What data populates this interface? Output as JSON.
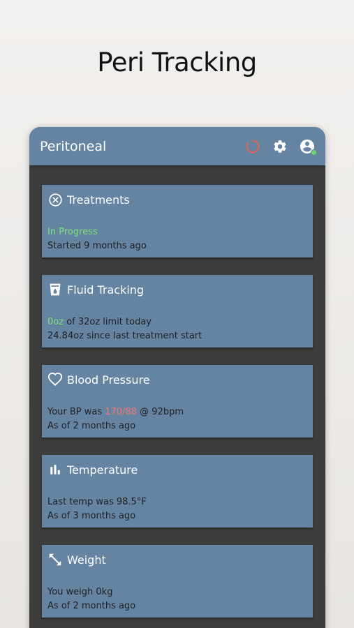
{
  "hero": {
    "title": "Peri Tracking"
  },
  "appbar": {
    "title": "Peritoneal",
    "actions": [
      {
        "icon": "loading-spinner-icon",
        "color": "#e06458"
      },
      {
        "icon": "gear-icon"
      },
      {
        "icon": "account-circle-icon",
        "badge_color": "#6ad477"
      }
    ]
  },
  "cards": {
    "treatments": {
      "icon": "close-circle-icon",
      "title": "Treatments",
      "status": "In Progress",
      "line2": "Started 9 months ago"
    },
    "fluid": {
      "icon": "cup-icon",
      "title": "Fluid Tracking",
      "amount": "0oz",
      "limit_text": " of 32oz limit today",
      "line2": "24.84oz since last treatment start"
    },
    "bp": {
      "icon": "heart-icon",
      "title": "Blood Pressure",
      "prefix": "Your BP was ",
      "value": "170/88",
      "suffix": " @ 92bpm",
      "line2": "As of 2 months ago"
    },
    "temperature": {
      "icon": "bar-chart-icon",
      "title": "Temperature",
      "line1": "Last temp was 98.5°F",
      "line2": "As of 3 months ago"
    },
    "weight": {
      "icon": "expand-diagonal-icon",
      "title": "Weight",
      "line1": "You weigh 0kg",
      "line2": "As of 2 months ago"
    }
  },
  "colors": {
    "primary": "#6484a2",
    "background": "#3d3d3d",
    "accent_green": "#7ee07a",
    "accent_red": "#e97c6e"
  }
}
